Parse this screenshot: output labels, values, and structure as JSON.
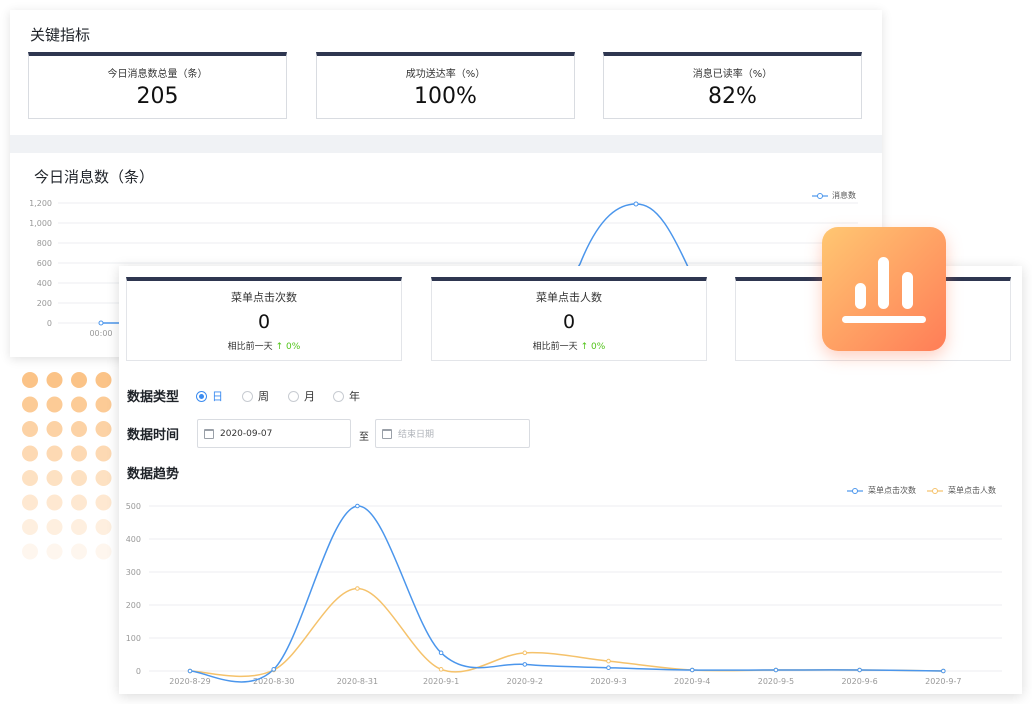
{
  "overview": {
    "title": "关键指标",
    "kpis": [
      {
        "label": "今日消息数总量（条）",
        "value": "205"
      },
      {
        "label": "成功送达率（%）",
        "value": "100%"
      },
      {
        "label": "消息已读率（%）",
        "value": "82%"
      }
    ],
    "chart_title": "今日消息数（条）"
  },
  "menu": {
    "cards": [
      {
        "label": "菜单点击次数",
        "value": "0",
        "compare_label": "相比前一天",
        "compare_value": "↑ 0%"
      },
      {
        "label": "菜单点击人数",
        "value": "0",
        "compare_label": "相比前一天",
        "compare_value": "↑ 0%"
      }
    ],
    "data_type": {
      "label": "数据类型",
      "options": [
        "日",
        "周",
        "月",
        "年"
      ],
      "selected": "日"
    },
    "data_time": {
      "label": "数据时间",
      "start_value": "2020-09-07",
      "end_placeholder": "结束日期",
      "separator": "至"
    },
    "trend_title": "数据趋势"
  },
  "colors": {
    "accent": "#3c8cf0",
    "series_clicks": "#4b96ec",
    "series_users": "#f5c26b",
    "card_bar": "#2e3650",
    "up": "#52c41a"
  },
  "chart_data": [
    {
      "type": "line",
      "title": "今日消息数（条）",
      "x": [
        "00:00"
      ],
      "series": [
        {
          "name": "消息数",
          "values": [
            0
          ]
        }
      ],
      "peak": {
        "value": 1190
      },
      "yticks": [
        "0",
        "200",
        "400",
        "600",
        "800",
        "1,000",
        "1,200"
      ],
      "ylim": [
        0,
        1200
      ],
      "legend": "top-right",
      "grid": true
    },
    {
      "type": "line",
      "title": "数据趋势",
      "categories": [
        "2020-8-29",
        "2020-8-30",
        "2020-8-31",
        "2020-9-1",
        "2020-9-2",
        "2020-9-3",
        "2020-9-4",
        "2020-9-5",
        "2020-9-6",
        "2020-9-7"
      ],
      "series": [
        {
          "name": "菜单点击次数",
          "values": [
            0,
            5,
            500,
            55,
            20,
            10,
            3,
            3,
            3,
            0
          ]
        },
        {
          "name": "菜单点击人数",
          "values": [
            0,
            3,
            250,
            5,
            55,
            30,
            3,
            3,
            3,
            0
          ]
        }
      ],
      "yticks": [
        "0",
        "100",
        "200",
        "300",
        "400",
        "500"
      ],
      "ylim": [
        0,
        500
      ],
      "legend": "top-right",
      "grid": true
    }
  ]
}
